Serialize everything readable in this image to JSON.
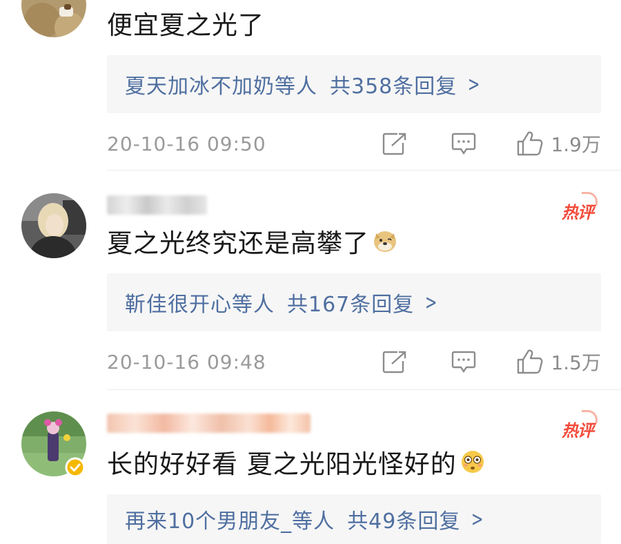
{
  "comments": [
    {
      "text": "便宜夏之光了",
      "reply_users": "夏天加冰不加奶等人",
      "reply_count": "共358条回复",
      "timestamp": "20-10-16 09:50",
      "likes": "1.9万",
      "hot": false
    },
    {
      "text": "夏之光终究还是高攀了",
      "emoji": "doge-emoji",
      "reply_users": "靳佳很开心等人",
      "reply_count": "共167条回复",
      "timestamp": "20-10-16 09:48",
      "likes": "1.5万",
      "hot": true,
      "hot_label": "热评"
    },
    {
      "text": "长的好好看 夏之光阳光怪好的",
      "emoji": "flushed-emoji",
      "reply_users": "再来10个男朋友_等人",
      "reply_count": "共49条回复",
      "hot": true,
      "hot_label": "热评",
      "verified": true
    }
  ],
  "icons": {
    "share": "share-icon",
    "reply": "comment-icon",
    "like": "thumbs-up-icon",
    "chevron": "chevron-right-icon"
  },
  "colors": {
    "link": "#4f6fa0",
    "hot": "#f24b3b",
    "muted": "#9a9a9a",
    "reply_bg": "#f6f6f6",
    "verified": "#f5b800"
  }
}
